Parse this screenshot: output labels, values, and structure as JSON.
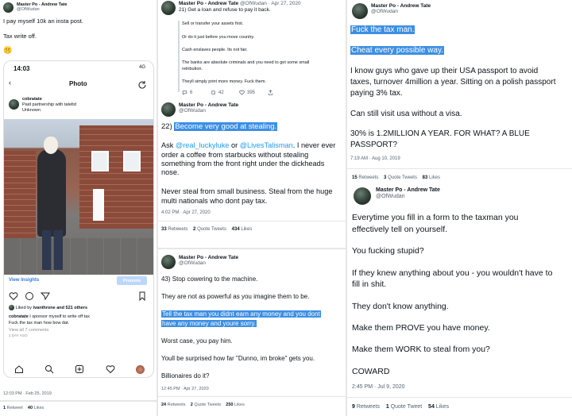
{
  "author": {
    "display_name": "Master Po - Andrew Tate",
    "handle": "@OfWudan"
  },
  "tweet1": {
    "lines": [
      "I pay myself 10k an insta post.",
      "Tax write off."
    ],
    "emoji": "🤫",
    "phone": {
      "time": "14:03",
      "signal": "4G",
      "screen_title": "Photo",
      "username": "cobratate",
      "paid_partnership": "Paid partnership with tateltd",
      "location": "Unknown",
      "view_insights": "View Insights",
      "promote": "Promote",
      "liked_by_prefix": "Liked by",
      "liked_by_user": "ivanthrone",
      "liked_by_others": "and 521 others",
      "caption_user": "cobratate",
      "caption_1": "I sponsor myself to write off tax",
      "caption_2": "Fuck the tax man how bow dat.",
      "view_comments": "View all 7 comments",
      "age": "1 DAY AGO"
    },
    "timestamp": "12:03 PM · Feb 25, 2019",
    "retweets": "1",
    "retweets_label": "Retweet",
    "likes": "40",
    "likes_label": "Likes"
  },
  "tweet2": {
    "date": "Apr 27, 2020",
    "lines": [
      "21) Get a loan and refuse to pay it back.",
      "Sell or transfer your assets first.",
      "Or do it just before you move country.",
      "Cash enslaves people. Its not fair.",
      "The banks are absolute criminals and you need to get some small",
      "retribution.",
      "Theyll simply print more money. Fuck them."
    ],
    "reply_count": "6",
    "retweet_count": "42",
    "like_count": "395"
  },
  "tweet3": {
    "prefix": "22) ",
    "highlight": "Become very good at stealing.",
    "ask_line_1_a": "Ask ",
    "mention1": "@real_luckyluke",
    "ask_line_1_b": " or ",
    "mention2": "@LivesTalisman",
    "ask_line_1_c": ". I never ever",
    "ask_line_2": "order a coffee from starbucks without stealing",
    "ask_line_3": "something from the front right under the dickheads",
    "ask_line_4": "nose.",
    "never_1": "Never steal from small business. Steal from the huge",
    "never_2": "multi nationals who dont pay tax.",
    "timestamp": "4:02 PM · Apr 27, 2020",
    "retweets": "33",
    "retweets_label": "Retweets",
    "quotes": "2",
    "quotes_label": "Quote Tweets",
    "likes": "434",
    "likes_label": "Likes"
  },
  "tweet4": {
    "line1": "43) Stop cowering to the machine.",
    "line2": "They are not as powerful as you imagine them to be.",
    "hl1": "Tell the tax man you didnt earn any money and you dont",
    "hl2": "have any money and youre sorry.",
    "line3": "Worst case, you pay him.",
    "line4": "Youll be surprised how far \"Dunno, im broke\" gets you.",
    "line5": "Billionaires do it?",
    "timestamp": "12:45 PM · Apr 27, 2020",
    "retweets": "24",
    "retweets_label": "Retweets",
    "quotes": "2",
    "quotes_label": "Quote Tweets",
    "likes": "250",
    "likes_label": "Likes"
  },
  "tweet5": {
    "hl1": "Fuck the tax man.",
    "hl2": "Cheat every possible way.",
    "p1_1": "I know guys who gave up their USA passport to avoid",
    "p1_2": "taxes, turnover 4million a year. Sitting on a polish passport",
    "p1_3": "paying 3% tax.",
    "p2": "Can still visit usa without a visa.",
    "p3_1": "30% is 1.2MILLION A YEAR. FOR WHAT? A BLUE",
    "p3_2": "PASSPORT?",
    "timestamp": "7:19 AM · Aug 10, 2019",
    "retweets": "15",
    "retweets_label": "Retweets",
    "quotes": "3",
    "quotes_label": "Quote Tweets",
    "likes": "83",
    "likes_label": "Likes"
  },
  "tweet6": {
    "l1": "Everytime you fill in a form to the taxman you",
    "l2": "effectively tell on yourself.",
    "l3": "You fucking stupid?",
    "l4": "If they knew anything about you - you wouldn't have to",
    "l5": "fill in shit.",
    "l6": "They don't know anything.",
    "l7": "Make them PROVE you have money.",
    "l8": "Make them WORK to steal from you?",
    "l9": "COWARD",
    "timestamp": "2:45 PM · Jul 9, 2020",
    "retweets": "9",
    "retweets_label": "Retweets",
    "quotes": "1",
    "quotes_label": "Quote Tweet",
    "likes": "54",
    "likes_label": "Likes"
  }
}
